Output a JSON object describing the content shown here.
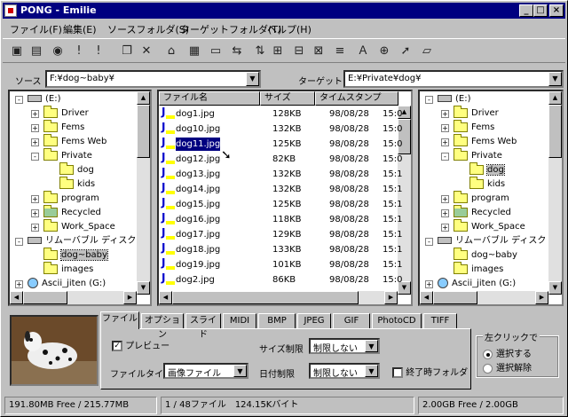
{
  "window": {
    "title": "PONG - Emilie",
    "min": "_",
    "max": "□",
    "close": "×"
  },
  "menu": [
    "ファイル(F)",
    "編集(E)",
    "ソースフォルダ(S)",
    "ターゲットフォルダ(T)",
    "ヘルプ(H)"
  ],
  "toolbar": [
    {
      "icon": "image-window-icon",
      "glyph": "▣"
    },
    {
      "icon": "monitor-icon",
      "glyph": "▤"
    },
    {
      "icon": "eye-icon",
      "glyph": "◉"
    },
    {
      "icon": "exclamation-gray-icon",
      "glyph": "!"
    },
    {
      "icon": "exclamation-icon",
      "glyph": "!"
    },
    {
      "icon": "copy-icon",
      "glyph": "❐"
    },
    {
      "icon": "delete-icon",
      "glyph": "✕"
    },
    {
      "icon": "stamp-icon",
      "glyph": "⌂"
    },
    {
      "icon": "list-icon",
      "glyph": "▦"
    },
    {
      "icon": "document-icon",
      "glyph": "▭"
    },
    {
      "icon": "rename-icon",
      "glyph": "⇆"
    },
    {
      "icon": "sort-icon",
      "glyph": "⇅"
    },
    {
      "icon": "tree-copy-icon",
      "glyph": "⊞"
    },
    {
      "icon": "tree-move-icon",
      "glyph": "⊟"
    },
    {
      "icon": "tree-delete-icon",
      "glyph": "⊠"
    },
    {
      "icon": "properties-icon",
      "glyph": "≡"
    },
    {
      "icon": "font-icon",
      "glyph": "Ａ"
    },
    {
      "icon": "filter-icon",
      "glyph": "⊕"
    },
    {
      "icon": "send-icon",
      "glyph": "➚"
    },
    {
      "icon": "note-icon",
      "glyph": "▱"
    }
  ],
  "source": {
    "label": "ソース",
    "path": "F:¥dog~baby¥"
  },
  "target": {
    "label": "ターゲット",
    "path": "E:¥Private¥dog¥"
  },
  "left_tree": [
    {
      "label": "(E:)",
      "kind": "drive",
      "indent": 0,
      "exp": "-"
    },
    {
      "label": "Driver",
      "kind": "folder",
      "indent": 1,
      "exp": "+"
    },
    {
      "label": "Fems",
      "kind": "folder",
      "indent": 1,
      "exp": "+"
    },
    {
      "label": "Fems Web",
      "kind": "folder",
      "indent": 1,
      "exp": "+"
    },
    {
      "label": "Private",
      "kind": "folder",
      "indent": 1,
      "exp": "-"
    },
    {
      "label": "dog",
      "kind": "folder",
      "indent": 2,
      "exp": ""
    },
    {
      "label": "kids",
      "kind": "folder",
      "indent": 2,
      "exp": ""
    },
    {
      "label": "program",
      "kind": "folder",
      "indent": 1,
      "exp": "+"
    },
    {
      "label": "Recycled",
      "kind": "recycle",
      "indent": 1,
      "exp": "+"
    },
    {
      "label": "Work_Space",
      "kind": "folder",
      "indent": 1,
      "exp": "+"
    },
    {
      "label": "リムーバブル ディスク",
      "kind": "drive",
      "indent": 0,
      "exp": "-"
    },
    {
      "label": "dog~baby",
      "kind": "folder-open",
      "indent": 1,
      "exp": "",
      "selected": true
    },
    {
      "label": "images",
      "kind": "folder",
      "indent": 1,
      "exp": ""
    },
    {
      "label": "Ascii_jiten (G:)",
      "kind": "cd",
      "indent": 0,
      "exp": "+"
    }
  ],
  "right_tree": [
    {
      "label": "(E:)",
      "kind": "drive",
      "indent": 0,
      "exp": "-"
    },
    {
      "label": "Driver",
      "kind": "folder",
      "indent": 1,
      "exp": "+"
    },
    {
      "label": "Fems",
      "kind": "folder",
      "indent": 1,
      "exp": "+"
    },
    {
      "label": "Fems Web",
      "kind": "folder",
      "indent": 1,
      "exp": "+"
    },
    {
      "label": "Private",
      "kind": "folder",
      "indent": 1,
      "exp": "-"
    },
    {
      "label": "dog",
      "kind": "folder-open",
      "indent": 2,
      "exp": "",
      "selected": true
    },
    {
      "label": "kids",
      "kind": "folder",
      "indent": 2,
      "exp": ""
    },
    {
      "label": "program",
      "kind": "folder",
      "indent": 1,
      "exp": "+"
    },
    {
      "label": "Recycled",
      "kind": "recycle",
      "indent": 1,
      "exp": "+"
    },
    {
      "label": "Work_Space",
      "kind": "folder",
      "indent": 1,
      "exp": "+"
    },
    {
      "label": "リムーバブル ディスク",
      "kind": "drive",
      "indent": 0,
      "exp": "-"
    },
    {
      "label": "dog~baby",
      "kind": "folder",
      "indent": 1,
      "exp": ""
    },
    {
      "label": "images",
      "kind": "folder",
      "indent": 1,
      "exp": ""
    },
    {
      "label": "Ascii_jiten (G:)",
      "kind": "cd",
      "indent": 0,
      "exp": "+"
    }
  ],
  "file_list": {
    "headers": [
      "ファイル名",
      "サイズ",
      "タイムスタンプ"
    ],
    "rows": [
      {
        "name": "dog1.jpg",
        "size": "128KB",
        "date": "98/08/28",
        "time": "15:0"
      },
      {
        "name": "dog10.jpg",
        "size": "132KB",
        "date": "98/08/28",
        "time": "15:0"
      },
      {
        "name": "dog11.jpg",
        "size": "125KB",
        "date": "98/08/28",
        "time": "15:0",
        "selected": true
      },
      {
        "name": "dog12.jpg",
        "size": "82KB",
        "date": "98/08/28",
        "time": "15:0"
      },
      {
        "name": "dog13.jpg",
        "size": "132KB",
        "date": "98/08/28",
        "time": "15:1"
      },
      {
        "name": "dog14.jpg",
        "size": "132KB",
        "date": "98/08/28",
        "time": "15:1"
      },
      {
        "name": "dog15.jpg",
        "size": "125KB",
        "date": "98/08/28",
        "time": "15:1"
      },
      {
        "name": "dog16.jpg",
        "size": "118KB",
        "date": "98/08/28",
        "time": "15:1"
      },
      {
        "name": "dog17.jpg",
        "size": "129KB",
        "date": "98/08/28",
        "time": "15:1"
      },
      {
        "name": "dog18.jpg",
        "size": "133KB",
        "date": "98/08/28",
        "time": "15:1"
      },
      {
        "name": "dog19.jpg",
        "size": "101KB",
        "date": "98/08/28",
        "time": "15:1"
      },
      {
        "name": "dog2.jpg",
        "size": "86KB",
        "date": "98/08/28",
        "time": "15:0"
      }
    ]
  },
  "tabs": [
    "ファイル",
    "オプション",
    "スライド",
    "MIDI",
    "BMP",
    "JPEG",
    "GIF",
    "PhotoCD",
    "TIFF"
  ],
  "options": {
    "preview_label": "プレビュー",
    "preview_checked": "✓",
    "filetype_label": "ファイルタイプ",
    "filetype_value": "画像ファイル",
    "size_limit_label": "サイズ制限",
    "size_limit_value": "制限しない",
    "date_limit_label": "日付制限",
    "date_limit_value": "制限しない",
    "exit_folder_label": "終了時フォルダ",
    "left_click_label": "左クリックで",
    "select_label": "選択する",
    "deselect_label": "選択解除"
  },
  "status": {
    "left": "191.80MB Free / 215.77MB",
    "middle": "1 / 48ファイル　124.15Kバイト",
    "right": "2.00GB Free / 2.00GB"
  },
  "colors": {
    "titlebar": "#000080",
    "face": "#c0c0c0",
    "selection": "#000080"
  }
}
